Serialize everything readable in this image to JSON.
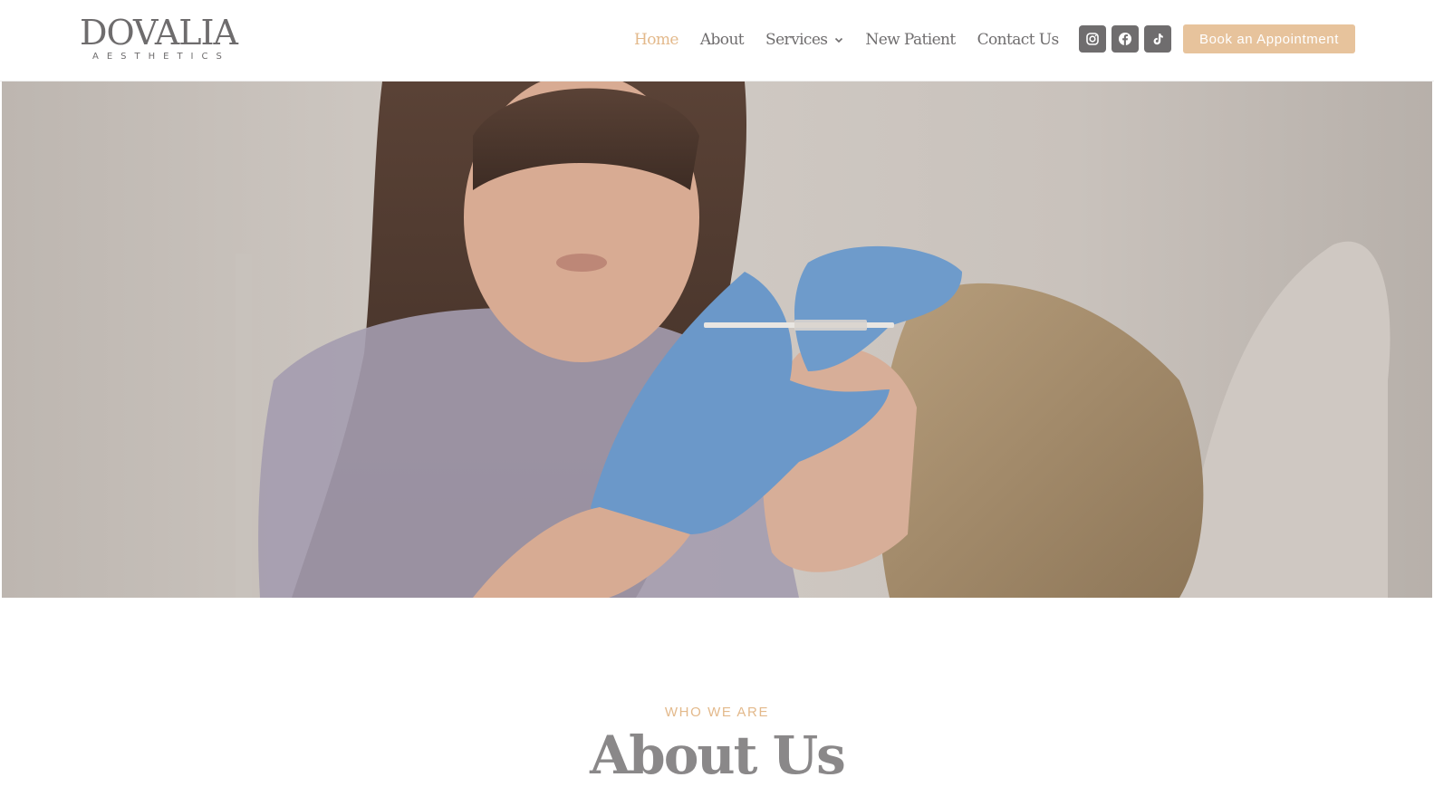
{
  "logo": {
    "name": "DOVALIA",
    "tagline": "AESTHETICS"
  },
  "nav": {
    "items": [
      {
        "label": "Home",
        "active": true
      },
      {
        "label": "About",
        "active": false
      },
      {
        "label": "Services",
        "active": false,
        "has_dropdown": true
      },
      {
        "label": "New Patient",
        "active": false
      },
      {
        "label": "Contact Us",
        "active": false
      }
    ]
  },
  "socials": [
    {
      "icon": "instagram-icon"
    },
    {
      "icon": "facebook-icon"
    },
    {
      "icon": "tiktok-icon"
    }
  ],
  "cta": {
    "label": "Book an Appointment"
  },
  "hero": {
    "image": "aesthetic-injection-treatment-photo"
  },
  "about": {
    "eyebrow": "WHO WE ARE",
    "title": "About Us"
  },
  "colors": {
    "accent": "#e3b98b",
    "button": "#e7c39c",
    "text": "#6f6d6e",
    "social_bg": "#6f6d6e"
  }
}
